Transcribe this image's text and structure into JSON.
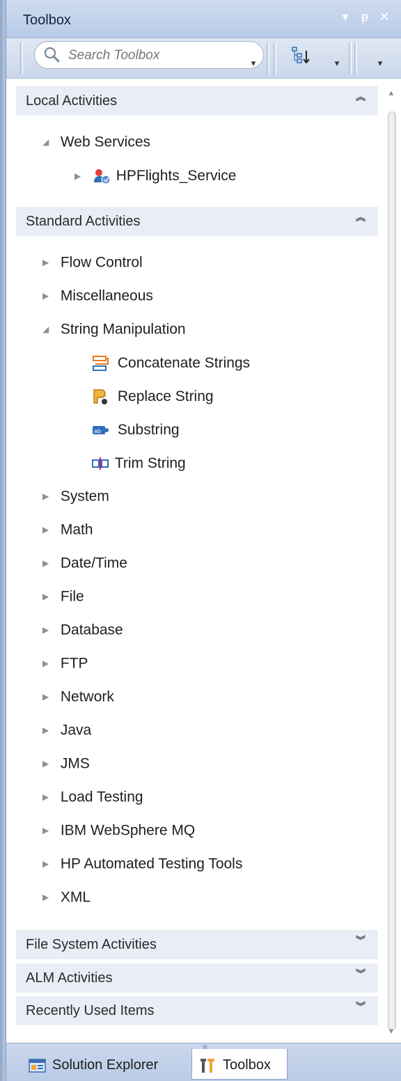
{
  "panel": {
    "title": "Toolbox",
    "controls": [
      "▾",
      "ᵽ",
      "✕"
    ]
  },
  "toolbar": {
    "search_placeholder": "Search Toolbox"
  },
  "categories": {
    "local": {
      "label": "Local Activities",
      "chev": "︽"
    },
    "standard": {
      "label": "Standard Activities",
      "chev": "︽"
    },
    "filesystem": {
      "label": "File System Activities",
      "chev": "︾"
    },
    "alm": {
      "label": "ALM Activities",
      "chev": "︾"
    },
    "recent": {
      "label": "Recently Used Items",
      "chev": "︾"
    }
  },
  "local": {
    "web_services": "Web Services",
    "hpflights": "HPFlights_Service"
  },
  "standard": {
    "flow_control": "Flow Control",
    "misc": "Miscellaneous",
    "string_manipulation": "String Manipulation",
    "concatenate": "Concatenate Strings",
    "replace": "Replace String",
    "substring": "Substring",
    "trim": "Trim String",
    "system": "System",
    "math": "Math",
    "datetime": "Date/Time",
    "file": "File",
    "database": "Database",
    "ftp": "FTP",
    "network": "Network",
    "java": "Java",
    "jms": "JMS",
    "load_testing": "Load Testing",
    "ibm_mq": "IBM WebSphere MQ",
    "hp_tools": "HP Automated Testing Tools",
    "xml": "XML"
  },
  "tabs": {
    "solution_explorer": "Solution Explorer",
    "toolbox": "Toolbox"
  },
  "colors": {
    "titlebar": "#b7cbe8",
    "category_bg": "#e9eef6",
    "accent_orange": "#f2a33a",
    "accent_blue": "#2f6fb8"
  }
}
